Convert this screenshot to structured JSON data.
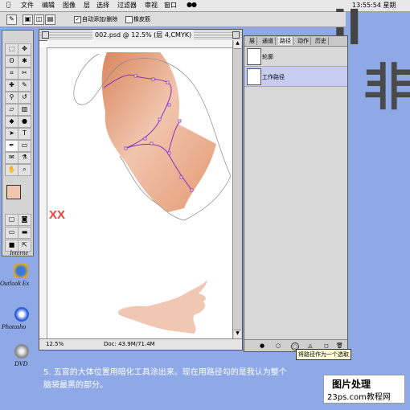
{
  "menubar": {
    "items": [
      "文件",
      "编辑",
      "图像",
      "层",
      "选择",
      "过滤器",
      "审视",
      "窗口"
    ],
    "clock": "13:55:54 星期"
  },
  "options_bar": {
    "auto_add_delete": "自动添加/删除",
    "rubber_band": "橡皮筋"
  },
  "desktop": {
    "big_letters": [
      "II",
      "非"
    ],
    "icons": [
      "Interne",
      "Outlook Ex",
      "Photosho",
      "DVD"
    ]
  },
  "document": {
    "title": "002.psd @ 12.5% (层 4,CMYK)",
    "zoom": "12.5%",
    "doc_size": "Doc: 43.9M/71.4M",
    "annotation": "XX"
  },
  "palette": {
    "tabs": [
      "层",
      "通道",
      "路径",
      "动作",
      "历史"
    ],
    "rows": [
      "轮廓",
      "工作路径"
    ],
    "tooltip": "将路径作为一个选取"
  },
  "caption": {
    "line1": "5. 五官的大体位置用暗化工具涂出来。现在用路径勾的是我认为整个",
    "line2": "脑袋最黑的部分。"
  },
  "watermark": {
    "line1": "图片处理",
    "line2": "23ps.com教程网"
  },
  "colors": {
    "desktop": "#8fa9e6",
    "skin_light": "#f1c5ae",
    "skin_dark": "#d9875f",
    "path_purple": "#8a2fbf",
    "annotation_red": "#e8443c"
  }
}
